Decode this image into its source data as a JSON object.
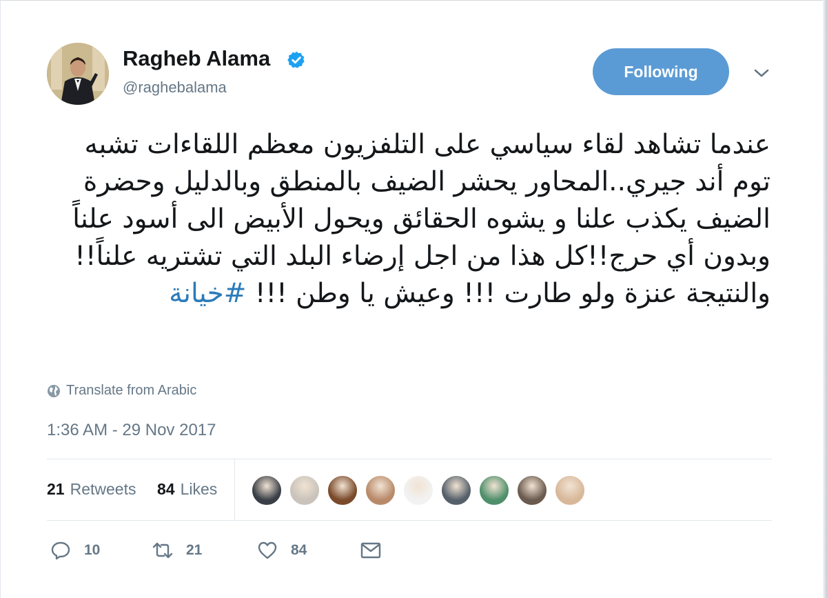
{
  "user": {
    "display_name": "Ragheb Alama",
    "handle": "@raghebalama",
    "verified": true,
    "avatar_icon": "profile-photo-man-in-tuxedo"
  },
  "header": {
    "follow_label": "Following",
    "follow_color": "#5b9bd5",
    "caret_icon": "chevron-down-icon"
  },
  "tweet": {
    "text": "عندما تشاهد لقاء سياسي على التلفزيون معظم اللقاءات تشبه توم أند جيري..المحاور يحشر الضيف بالمنطق وبالدليل وحضرة الضيف يكذب علنا و يشوه الحقائق ويحول الأبيض الى أسود علناً وبدون أي حرج!!كل هذا من اجل إرضاء البلد التي تشتريه علناً!!والنتيجة عنزة ولو طارت !!! وعيش يا وطن !!! ",
    "hashtag": "#خيانة",
    "hashtag_color": "#2b7bb9",
    "translate_label": "Translate from Arabic",
    "translate_icon": "globe-icon",
    "timestamp": "1:36 AM - 29 Nov 2017"
  },
  "stats": {
    "retweets_count": "21",
    "retweets_label": "Retweets",
    "likes_count": "84",
    "likes_label": "Likes"
  },
  "likers": [
    {
      "name": "liker-avatar-1",
      "color": "#3a3f47"
    },
    {
      "name": "liker-avatar-2",
      "color": "#c9c3bb"
    },
    {
      "name": "liker-avatar-3",
      "color": "#7a4a2a"
    },
    {
      "name": "liker-avatar-4",
      "color": "#b98a6a"
    },
    {
      "name": "liker-avatar-5",
      "color": "#f2f2f2"
    },
    {
      "name": "liker-avatar-6",
      "color": "#55606b"
    },
    {
      "name": "liker-avatar-7",
      "color": "#4f8f6a"
    },
    {
      "name": "liker-avatar-8",
      "color": "#6b5a4e"
    },
    {
      "name": "liker-avatar-9",
      "color": "#d8b89a"
    }
  ],
  "actions": {
    "reply_count": "10",
    "retweet_count": "21",
    "like_count": "84",
    "reply_icon": "reply-icon",
    "retweet_icon": "retweet-icon",
    "like_icon": "heart-icon",
    "dm_icon": "envelope-icon"
  }
}
